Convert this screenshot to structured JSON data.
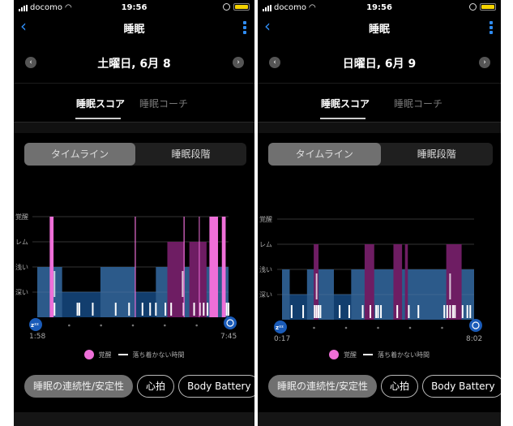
{
  "status_bar": {
    "carrier": "docomo",
    "time": "19:56"
  },
  "nav": {
    "back_icon": "chevron-left-icon",
    "title": "睡眠",
    "menu_icon": "kebab-menu-icon"
  },
  "tabs": [
    {
      "label": "睡眠スコア",
      "active": true
    },
    {
      "label": "睡眠コーチ",
      "active": false
    }
  ],
  "segmented": [
    {
      "label": "タイムライン",
      "active": true
    },
    {
      "label": "睡眠段階",
      "active": false
    }
  ],
  "legend": {
    "awake": "覚醒",
    "restless": "落ち着かない時間"
  },
  "chips": [
    {
      "label": "睡眠の連続性/安定性",
      "active": true
    },
    {
      "label": "心拍",
      "active": false
    },
    {
      "label": "Body Battery",
      "active": false
    }
  ],
  "colors": {
    "accent_blue": "#2f8cf3",
    "light_sleep": "#2c5a8a",
    "deep_sleep": "#123e6e",
    "rem": "#6e1d63",
    "awake": "#ee6fd8",
    "restless": "#ffffff",
    "battery": "#f5d300"
  },
  "screens": [
    {
      "date": "土曜日, 6月 8",
      "chart_data": {
        "type": "timeline",
        "levels": [
          "覚醒",
          "レム",
          "浅い",
          "深い"
        ],
        "start_time": "1:58",
        "end_time": "7:45",
        "segments_note": "x values are fractions of the sleep window (0=start,1=end)",
        "light_blocks": [
          [
            0.0,
            0.13
          ],
          [
            0.33,
            0.51
          ],
          [
            0.62,
            1.0
          ]
        ],
        "deep_blocks": [
          [
            0.0,
            1.0
          ]
        ],
        "gap_blocks": [
          [
            0.07,
            0.13,
            "light"
          ]
        ],
        "rem_blocks": [
          [
            0.68,
            0.77
          ],
          [
            0.795,
            0.885
          ]
        ],
        "awake_blocks": [
          [
            0.065,
            0.085
          ],
          [
            0.51,
            0.515
          ],
          [
            0.765,
            0.77
          ],
          [
            0.845,
            0.849
          ],
          [
            0.9,
            0.945
          ],
          [
            0.965,
            0.985
          ]
        ],
        "awake_thin": [
          [
            0.51,
            0.514
          ]
        ],
        "restless_marks": [
          [
            0.09,
            "tall"
          ],
          [
            0.09,
            "short"
          ],
          [
            0.21,
            "short"
          ],
          [
            0.22,
            "short"
          ],
          [
            0.29,
            "short"
          ],
          [
            0.41,
            "short"
          ],
          [
            0.48,
            "short"
          ],
          [
            0.55,
            "short"
          ],
          [
            0.59,
            "short"
          ],
          [
            0.62,
            "short"
          ],
          [
            0.67,
            "short"
          ],
          [
            0.7,
            "short"
          ],
          [
            0.76,
            "tall"
          ],
          [
            0.765,
            "short"
          ],
          [
            0.82,
            "short"
          ],
          [
            0.85,
            "short"
          ],
          [
            0.87,
            "short"
          ],
          [
            0.89,
            "short"
          ],
          [
            0.99,
            "short"
          ],
          [
            1.0,
            "short"
          ]
        ],
        "x_ticks": 5
      }
    },
    {
      "date": "日曜日, 6月 9",
      "chart_data": {
        "type": "timeline",
        "levels": [
          "覚醒",
          "レム",
          "浅い",
          "深い"
        ],
        "start_time": "0:17",
        "end_time": "8:02",
        "segments_note": "x values are fractions of the sleep window (0=start,1=end)",
        "light_blocks": [
          [
            0.0,
            0.04
          ],
          [
            0.13,
            0.27
          ],
          [
            0.36,
            1.0
          ]
        ],
        "deep_blocks": [
          [
            0.0,
            1.0
          ]
        ],
        "rem_blocks": [
          [
            0.165,
            0.19
          ],
          [
            0.43,
            0.48
          ],
          [
            0.58,
            0.625
          ],
          [
            0.64,
            0.655
          ],
          [
            0.855,
            0.935
          ]
        ],
        "awake_blocks": [],
        "restless_marks": [
          [
            0.05,
            "short"
          ],
          [
            0.11,
            "short"
          ],
          [
            0.17,
            "short"
          ],
          [
            0.18,
            "short"
          ],
          [
            0.18,
            "tall"
          ],
          [
            0.19,
            "short"
          ],
          [
            0.2,
            "short"
          ],
          [
            0.3,
            "short"
          ],
          [
            0.35,
            "short"
          ],
          [
            0.42,
            "short"
          ],
          [
            0.46,
            "short"
          ],
          [
            0.49,
            "short"
          ],
          [
            0.5,
            "short"
          ],
          [
            0.515,
            "short"
          ],
          [
            0.6,
            "short"
          ],
          [
            0.66,
            "short"
          ],
          [
            0.71,
            "short"
          ],
          [
            0.845,
            "short"
          ],
          [
            0.86,
            "short"
          ],
          [
            0.875,
            "short"
          ],
          [
            0.875,
            "tall"
          ],
          [
            0.89,
            "short"
          ],
          [
            0.9,
            "short"
          ],
          [
            0.94,
            "short"
          ],
          [
            0.965,
            "short"
          ],
          [
            0.98,
            "short"
          ]
        ],
        "x_ticks": 5
      }
    }
  ]
}
